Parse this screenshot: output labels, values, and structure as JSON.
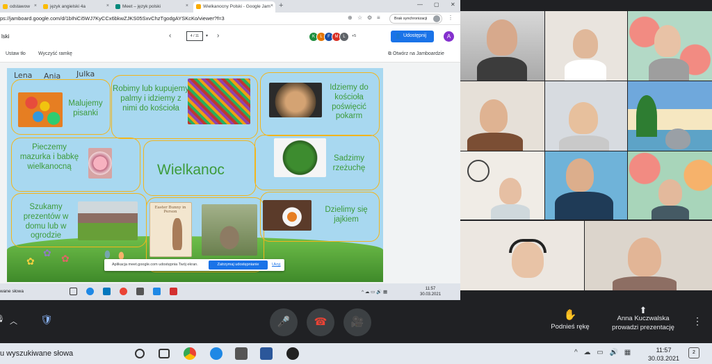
{
  "browser": {
    "tabs": [
      {
        "label": "odstawow"
      },
      {
        "label": "język angielski 4a"
      },
      {
        "label": "Meet – język polski"
      },
      {
        "label": "Wielkanocny Polski - Google Jam"
      }
    ],
    "new_tab": "+",
    "window_controls": [
      "—",
      "▢",
      "✕"
    ],
    "url": "ps://jamboard.google.com/d/1bIhiCi5WJ7KyCCx6bkwZJKS05SxvChzTgodgAYSKcKo/viewer?f=3",
    "sync_label": "Brak synchronizacji"
  },
  "jamboard": {
    "title": "lski",
    "frame_counter": "4 / 11",
    "prev": "‹",
    "next": "›",
    "collaborators": [
      {
        "letter": "K",
        "color": "#1e8e3e"
      },
      {
        "letter": "L",
        "color": "#e37400"
      },
      {
        "letter": "F",
        "color": "#174ea6"
      },
      {
        "letter": "M",
        "color": "#d93025"
      },
      {
        "letter": "L",
        "color": "#5f6368"
      }
    ],
    "more_collaborators": "+5",
    "share_label": "Udostępnij",
    "account_letter": "A",
    "toolbar": {
      "set_bg": "Ustaw tło",
      "clear_frame": "Wyczyść ramkę",
      "open_in": "Otwórz na Jamboardzie"
    },
    "handwritten_names": [
      "Lena",
      "Ania",
      "Julka"
    ],
    "boxes": [
      {
        "text": "Malujemy pisanki"
      },
      {
        "text": "Robimy lub kupujemy palmy i idziemy z nimi do kościoła"
      },
      {
        "text": "Idziemy do kościoła poświęcić pokarm"
      },
      {
        "text": "Pieczemy mazurka i babkę wielkanocną"
      },
      {
        "text": "Wielkanoc"
      },
      {
        "text": "Sadzimy rzeżuchę"
      },
      {
        "text": "Szukamy prezentów w domu lub w ogrodzie"
      },
      {
        "text": "Dzielimy się jajkiem"
      }
    ],
    "card_text": "Easter Bunny in Person"
  },
  "share_notice": {
    "text": "Aplikacja meet.google.com udostępnia Twój ekran.",
    "stop_label": "Zatrzymaj udostępnianie",
    "hide_label": "Ukryj"
  },
  "inner_taskbar": {
    "search": "wane słowa",
    "time": "11:57",
    "date": "30.03.2021"
  },
  "meet": {
    "raise_hand_label": "Podnieś rękę",
    "presenter_name": "Anna Kuczwalska",
    "presenter_status": "prowadzi prezentację",
    "mic_icon": "microphone-icon",
    "end_icon": "hangup-icon",
    "cam_icon": "camera-icon"
  },
  "taskbar": {
    "search": "u wyszukiwane słowa",
    "time": "11:57",
    "date": "30.03.2021",
    "notification_count": "2"
  },
  "colors": {
    "accent": "#1a73e8",
    "jam_text": "#3d9b3b",
    "box_border": "#f2b51b",
    "meet_bg": "#202124",
    "end_call": "#ea4335"
  }
}
